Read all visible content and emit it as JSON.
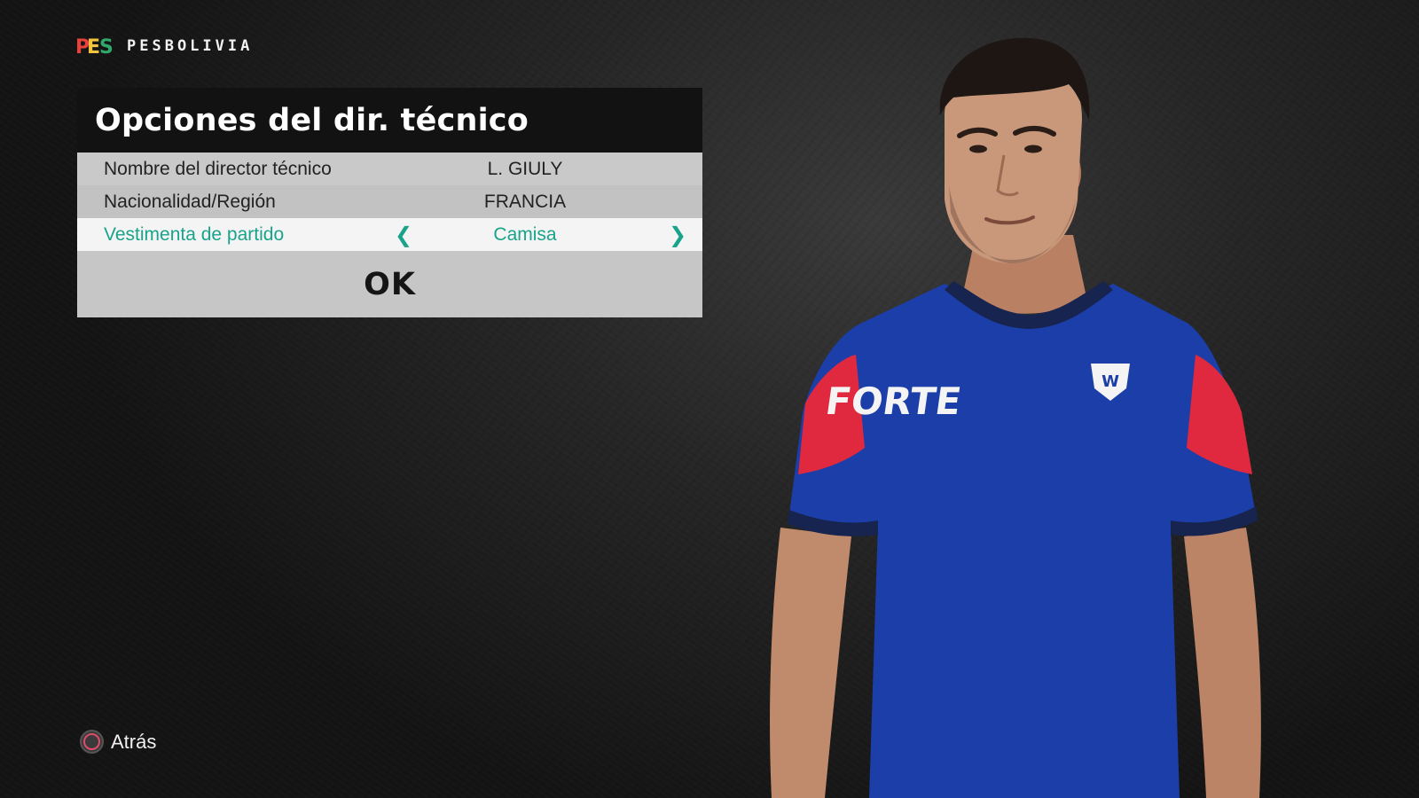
{
  "brand": {
    "name": "PESBOLIVIA",
    "logo_icon": "pes-logo-icon"
  },
  "panel": {
    "title": "Opciones del dir. técnico",
    "rows": [
      {
        "label": "Nombre del director técnico",
        "value": "L. GIULY"
      },
      {
        "label": "Nacionalidad/Región",
        "value": "FRANCIA"
      },
      {
        "label": "Vestimenta de partido",
        "value": "Camisa",
        "prev_arrow": "❮",
        "next_arrow": "❯"
      }
    ],
    "ok_label": "OK"
  },
  "footer": {
    "back_label": "Atrás",
    "back_icon": "circle-button-icon"
  },
  "portrait": {
    "shirt_sponsor": "FORTE",
    "colors": {
      "shirt": "#1c3ea8",
      "sleeve_accent": "#e0293f",
      "collar": "#17244f",
      "skin": "#c9987b",
      "hair": "#1d1613"
    }
  },
  "colors": {
    "accent": "#19a38a",
    "panel_header": "#121212",
    "row_bg": "#c9c9c9",
    "active_row_bg": "#f4f4f4"
  }
}
